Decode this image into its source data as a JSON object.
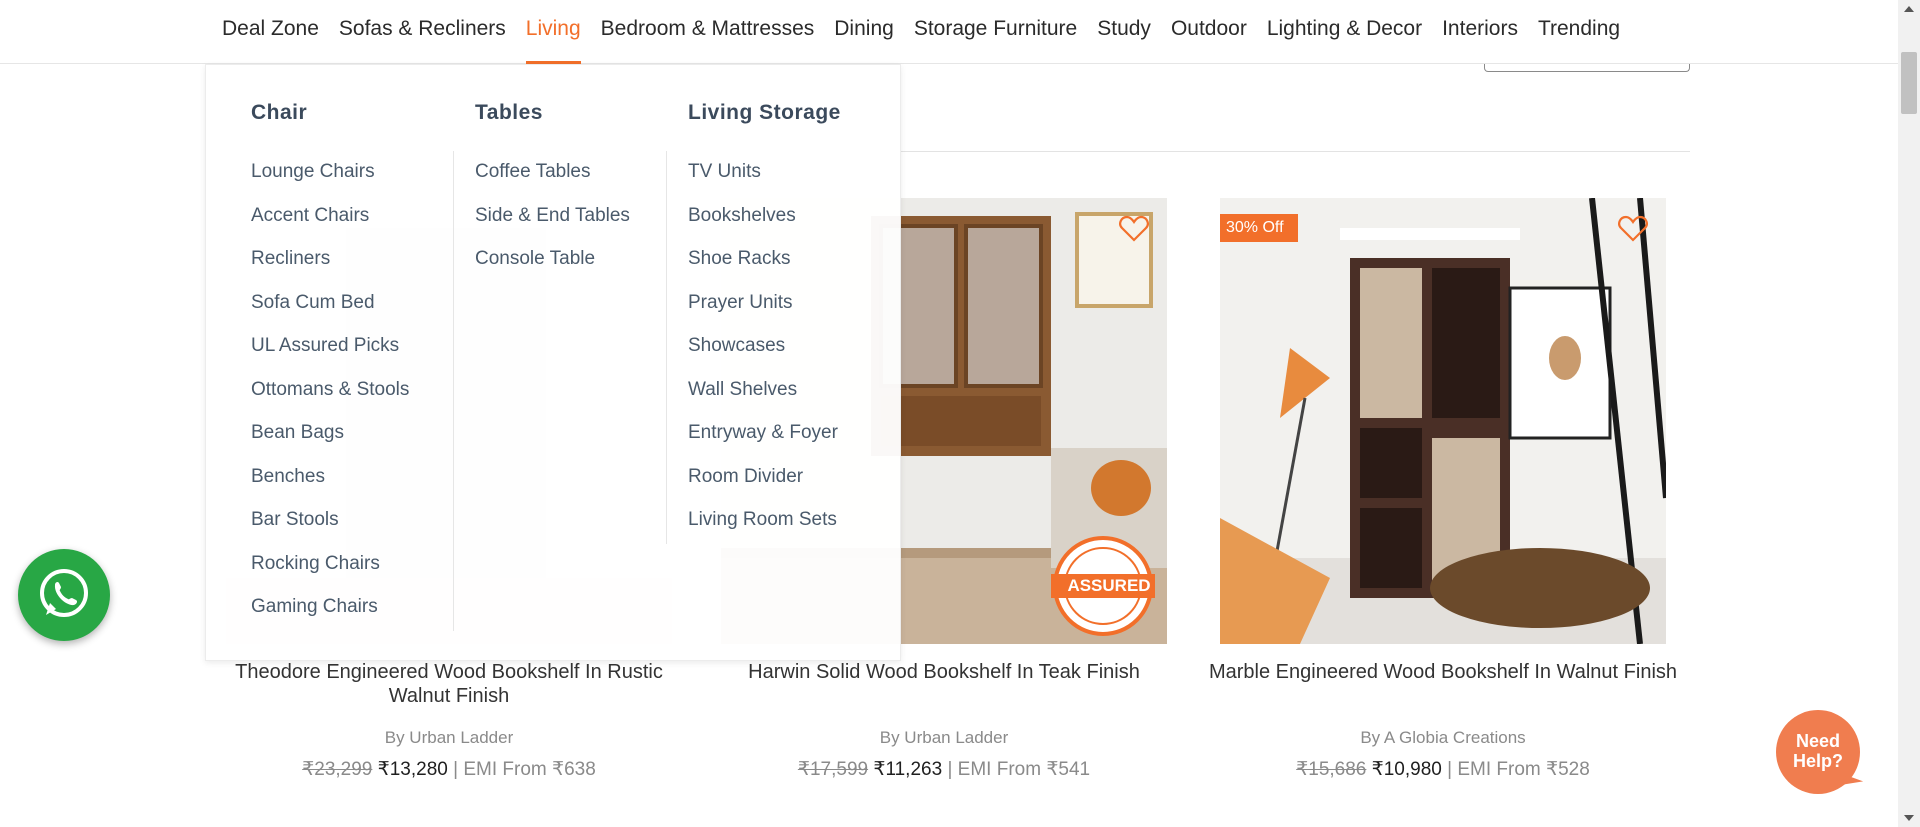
{
  "nav": {
    "items": [
      {
        "label": "Deal Zone"
      },
      {
        "label": "Sofas & Recliners"
      },
      {
        "label": "Living"
      },
      {
        "label": "Bedroom & Mattresses"
      },
      {
        "label": "Dining"
      },
      {
        "label": "Storage Furniture"
      },
      {
        "label": "Study"
      },
      {
        "label": "Outdoor"
      },
      {
        "label": "Lighting & Decor"
      },
      {
        "label": "Interiors"
      },
      {
        "label": "Trending"
      }
    ],
    "active": "Living"
  },
  "mega_menu": {
    "columns": [
      {
        "heading": "Chair",
        "items": [
          "Lounge Chairs",
          "Accent Chairs",
          "Recliners",
          "Sofa Cum Bed",
          "UL Assured Picks",
          "Ottomans & Stools",
          "Bean Bags",
          "Benches",
          "Bar Stools",
          "Rocking Chairs",
          "Gaming Chairs"
        ]
      },
      {
        "heading": "Tables",
        "items": [
          "Coffee Tables",
          "Side & End Tables",
          "Console Table"
        ]
      },
      {
        "heading": "Living Storage",
        "items": [
          "TV Units",
          "Bookshelves",
          "Shoe Racks",
          "Prayer Units",
          "Showcases",
          "Wall Shelves",
          "Entryway & Foyer",
          "Room Divider",
          "Living Room Sets"
        ]
      }
    ]
  },
  "products": [
    {
      "title": "Theodore Engineered Wood Bookshelf In Rustic Walnut Finish",
      "brand": "By Urban Ladder",
      "mrp": "₹23,299",
      "price": "₹13,280",
      "emi": "| EMI From ₹638",
      "badge": ""
    },
    {
      "title": "Harwin Solid Wood Bookshelf In Teak Finish",
      "brand": "By Urban Ladder",
      "mrp": "₹17,599",
      "price": "₹11,263",
      "emi": "| EMI From ₹541",
      "badge": "",
      "stamp": "ASSURED"
    },
    {
      "title": "Marble Engineered Wood Bookshelf In Walnut Finish",
      "brand": "By A Globia Creations",
      "mrp": "₹15,686",
      "price": "₹10,980",
      "emi": "| EMI From ₹528",
      "badge": "30% Off"
    }
  ],
  "help": {
    "label": "Need Help?"
  },
  "colors": {
    "accent": "#f26f2a",
    "whatsapp": "#28a745",
    "help": "#f07d4f",
    "menu_text": "#4a5a6b"
  },
  "icons": [
    "whatsapp-icon",
    "heart-icon"
  ]
}
